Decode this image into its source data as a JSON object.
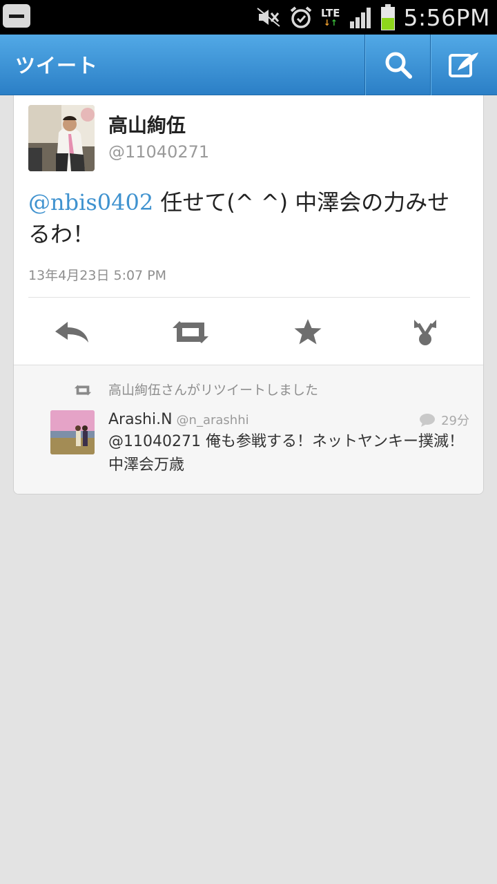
{
  "status_bar": {
    "time": "5:56PM",
    "network": "LTE"
  },
  "action_bar": {
    "title": "ツイート"
  },
  "tweet": {
    "name": "高山絢伍",
    "handle": "@11040271",
    "mention": "@nbis0402",
    "text": " 任せて(^ ^) 中澤会の力みせるわ！",
    "timestamp": "13年4月23日 5:07 PM"
  },
  "retweet": {
    "label": "高山絢伍さんがリツイートしました",
    "name": "Arashi.N",
    "handle": "@n_arashhi",
    "time": "29分",
    "text": "@11040271 俺も参戦する！ネットヤンキー撲滅！中澤会万歳"
  },
  "colors": {
    "accent": "#3f92cf",
    "actionbar": "#3b93d6"
  }
}
